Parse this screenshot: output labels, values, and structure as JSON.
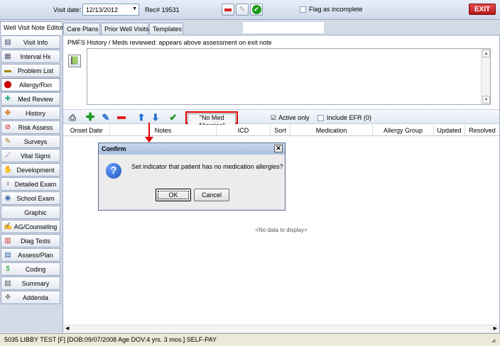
{
  "topbar": {
    "visit_date_label": "Visit date:",
    "visit_date_value": "12/13/2012",
    "rec_label": "Rec#",
    "rec_value": "19531",
    "flag_label": "Flag as incomplete",
    "exit_label": "EXIT"
  },
  "tabs": [
    {
      "label": "Well Visit Note Editor",
      "active": true
    },
    {
      "label": "Care Plans"
    },
    {
      "label": "Prior Well Visits"
    },
    {
      "label": "Templates"
    }
  ],
  "sidebar": {
    "items": [
      {
        "label": "Visit Info",
        "icon": "visit-info-icon"
      },
      {
        "label": "Interval Hx",
        "icon": "interval-hx-icon"
      },
      {
        "label": "Problem List",
        "icon": "problem-list-icon"
      },
      {
        "label": "Allergy/Rxn",
        "icon": "allergy-icon",
        "selected": true
      },
      {
        "label": "Med Review",
        "icon": "med-review-icon"
      },
      {
        "label": "History",
        "icon": "history-icon"
      },
      {
        "label": "Risk Assess",
        "icon": "risk-assess-icon"
      },
      {
        "label": "Surveys",
        "icon": "surveys-icon"
      },
      {
        "label": "Vital Signs",
        "icon": "vital-signs-icon"
      },
      {
        "label": "Development",
        "icon": "development-icon"
      },
      {
        "label": "Detailed Exam",
        "icon": "detailed-exam-icon"
      },
      {
        "label": "School Exam",
        "icon": "school-exam-icon"
      },
      {
        "label": "Graphic",
        "icon": "graphic-icon"
      },
      {
        "label": "AG/Counseling",
        "icon": "counseling-icon"
      },
      {
        "label": "Diag Tests",
        "icon": "diag-tests-icon"
      },
      {
        "label": "Assess/Plan",
        "icon": "assess-plan-icon"
      },
      {
        "label": "Coding",
        "icon": "coding-icon"
      },
      {
        "label": "Summary",
        "icon": "summary-icon"
      },
      {
        "label": "Addenda",
        "icon": "addenda-icon"
      }
    ]
  },
  "main": {
    "pmfs_text": "PMFS History / Meds reviewed: appears above assessment on exit note",
    "toolbar": {
      "no_med_allergies": "\"No Med Allergies\"",
      "active_only_label": "Active only",
      "include_efr_label": "Include EFR (0)"
    },
    "columns": [
      "Onset Date",
      "Notes",
      "ICD",
      "Sort",
      "Medication",
      "Allergy Group",
      "Updated",
      "Resolved"
    ],
    "no_data": "<No data to display>"
  },
  "dialog": {
    "title": "Confirm",
    "message": "Set indicator that patient has no medication allergies?",
    "ok_label": "OK",
    "cancel_label": "Cancel"
  },
  "status_bar": {
    "text": "5035 LIBBY TEST [F] [DOB:09/07/2008 Age DOV:4 yrs. 3 mos.] SELF-PAY"
  },
  "colors": {
    "exit_red": "#c41c1c",
    "highlight_red": "#e00000",
    "toolbar_green": "#1a9a1a",
    "toolbar_blue": "#1f6fd0"
  }
}
